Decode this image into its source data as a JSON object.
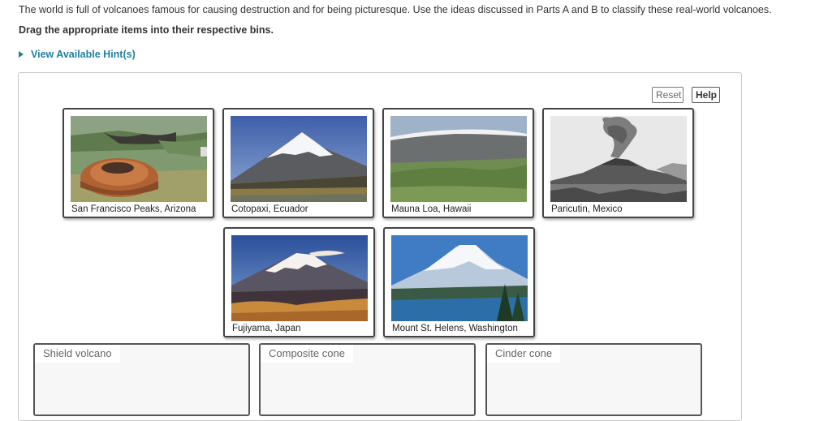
{
  "intro": "The world is full of volcanoes famous for causing destruction and for being picturesque.  Use the ideas discussed in Parts A and B to classify these real-world volcanoes.",
  "instruction": "Drag the appropriate items into their respective bins.",
  "hints_link": "View Available Hint(s)",
  "buttons": {
    "reset": "Reset",
    "help": "Help"
  },
  "cards": [
    {
      "label": "San Francisco Peaks, Arizona",
      "image": "cinder-cone-aerial-photo"
    },
    {
      "label": "Cotopaxi, Ecuador",
      "image": "snow-capped-cone-photo"
    },
    {
      "label": "Mauna Loa, Hawaii",
      "image": "broad-shield-photo"
    },
    {
      "label": "Paricutin, Mexico",
      "image": "erupting-cone-bw-photo"
    },
    {
      "label": "Fujiyama, Japan",
      "image": "snow-capped-cone-photo"
    },
    {
      "label": "Mount St. Helens, Washington",
      "image": "snow-capped-mountain-lake-photo"
    }
  ],
  "bins": [
    {
      "label": "Shield volcano"
    },
    {
      "label": "Composite cone"
    },
    {
      "label": "Cinder cone"
    }
  ]
}
